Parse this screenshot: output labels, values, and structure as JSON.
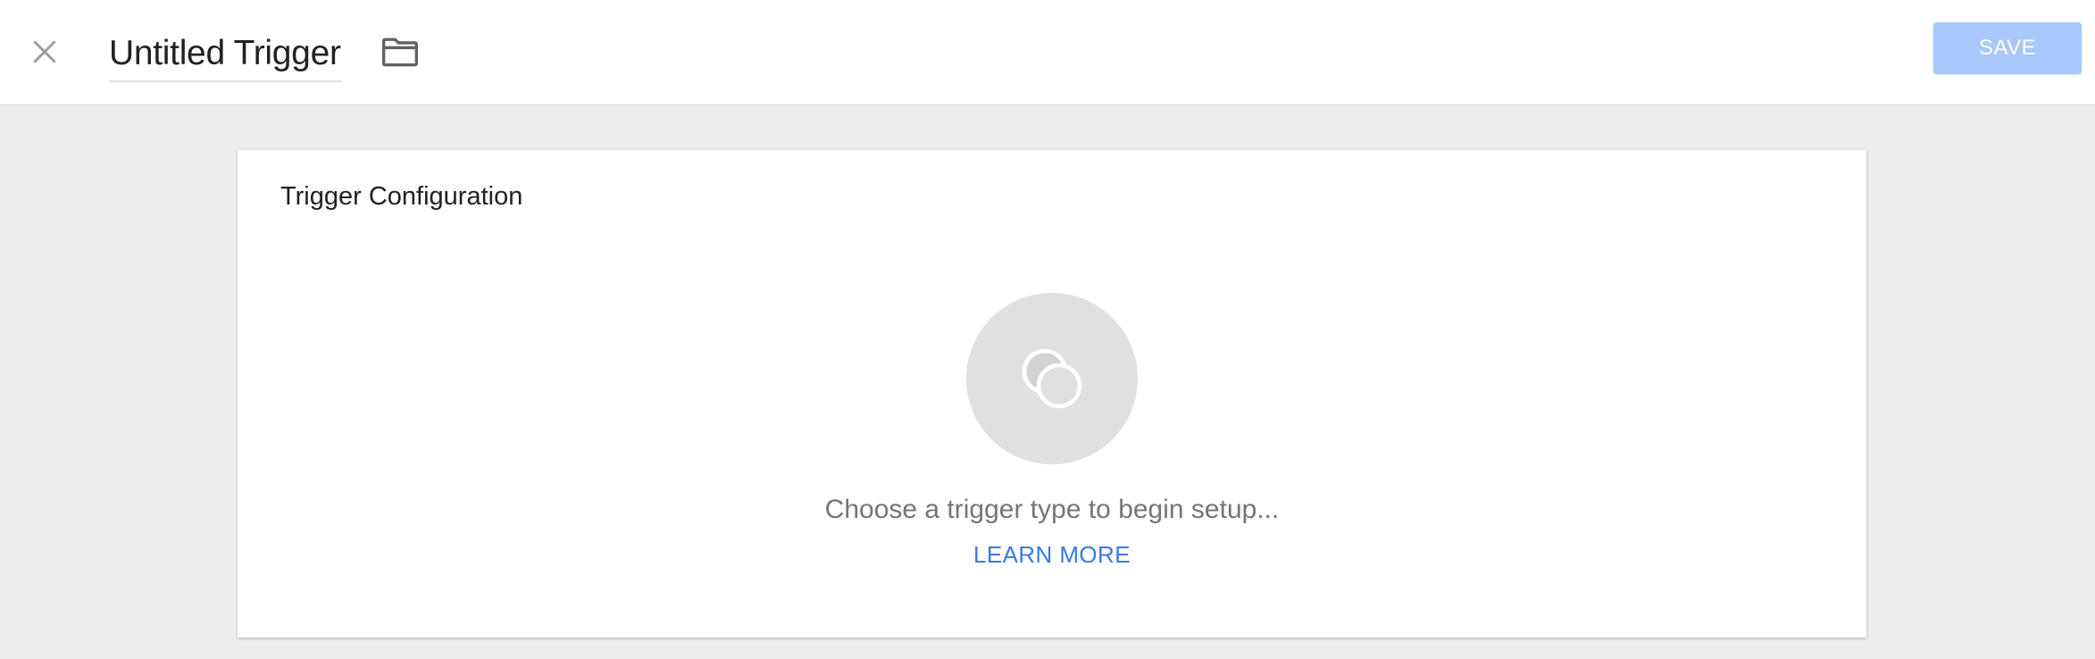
{
  "header": {
    "title": "Untitled Trigger",
    "close_icon": "close-icon",
    "folder_icon": "folder-icon",
    "save_label": "SAVE"
  },
  "card": {
    "title": "Trigger Configuration",
    "placeholder_icon": "trigger-type-icon",
    "empty_text": "Choose a trigger type to begin setup...",
    "learn_more_label": "LEARN MORE"
  },
  "colors": {
    "save_button_disabled": "#a8c7fa",
    "link": "#3b78e7",
    "background": "#ececec"
  }
}
